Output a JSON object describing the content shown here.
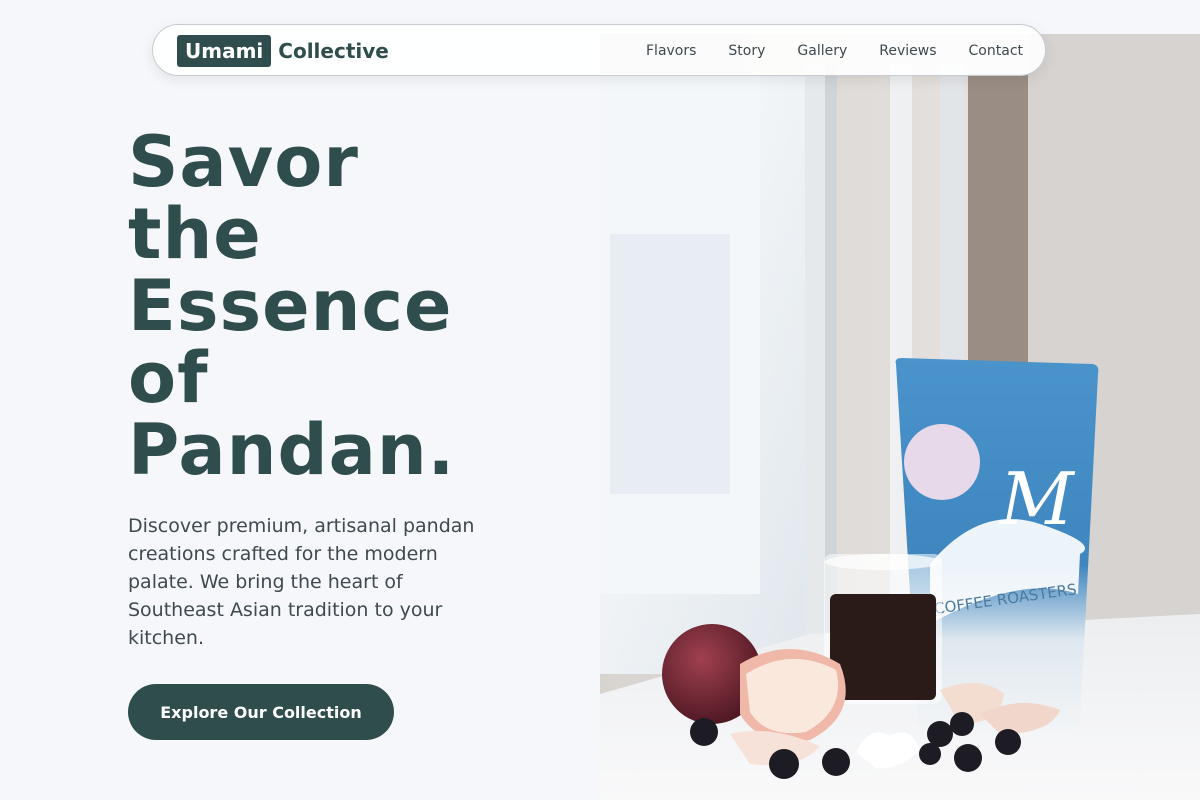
{
  "nav": {
    "brand_box": "Umami",
    "brand_rest": "Collective",
    "links": [
      "Flavors",
      "Story",
      "Gallery",
      "Reviews",
      "Contact"
    ]
  },
  "hero": {
    "headline_lines": [
      "Savor",
      "the",
      "Essence",
      "of",
      "Pandan."
    ],
    "intro": "Discover premium, artisanal pandan creations crafted for the modern palate. We bring the heart of Southeast Asian tradition to your kitchen.",
    "cta_label": "Explore Our Collection",
    "photo": {
      "bag_label_text": "COFFEE ROASTERS",
      "bag_logo_letter": "M"
    }
  },
  "colors": {
    "brand": "#2e4d4c",
    "page_bg": "#f6f7fb",
    "bag_blue": "#3f86bf",
    "text_body": "#3e4a4f"
  }
}
